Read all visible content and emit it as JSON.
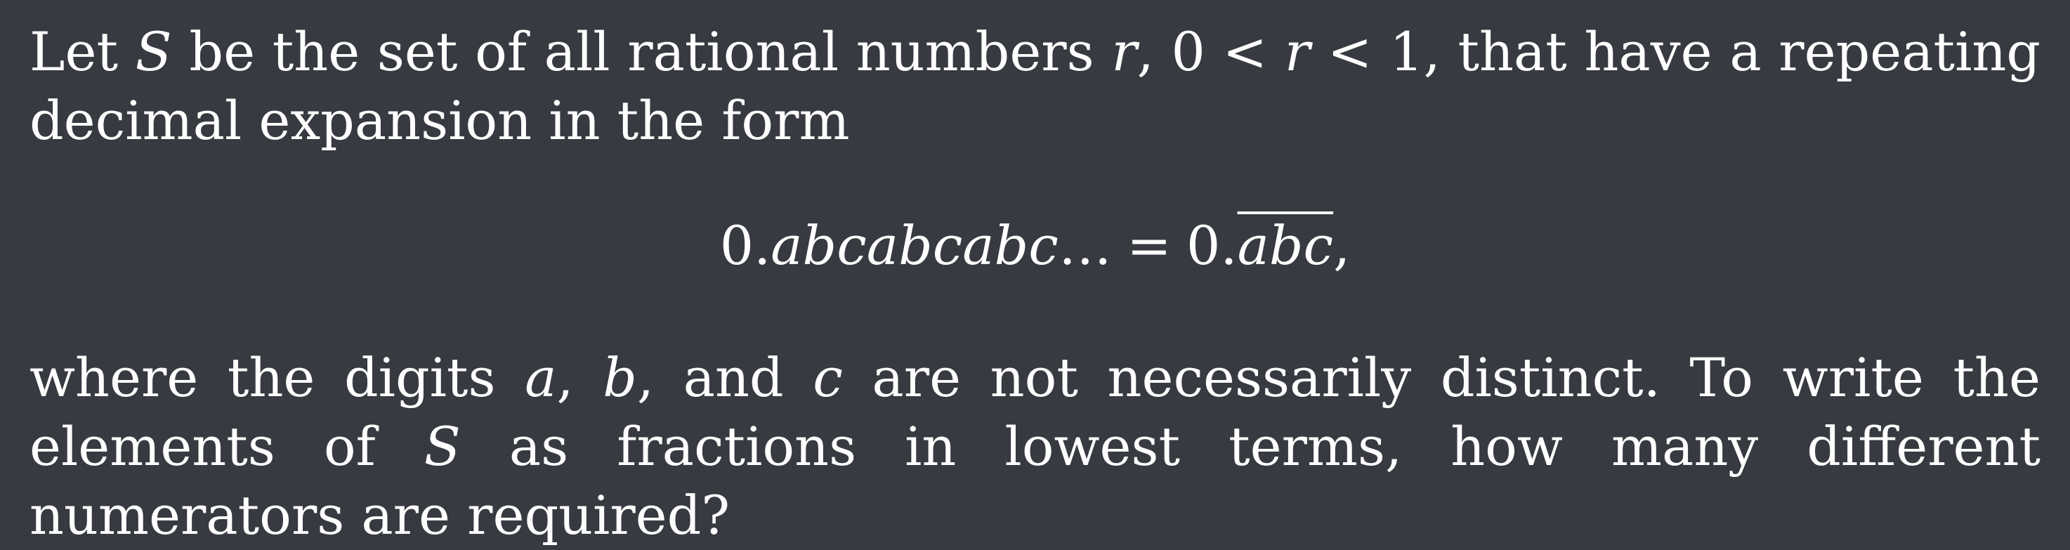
{
  "problem": {
    "p1": {
      "t1": "Let ",
      "v_S": "S",
      "t2": " be the set of all rational numbers ",
      "v_r1": "r",
      "t3": ", 0 < ",
      "v_r2": "r",
      "t4": " < 1, that have a repeating decimal expansion in the form"
    },
    "display": {
      "lead": "0.",
      "repeat": "abcabcabc",
      "dots": "…",
      "eq": "=",
      "lead2": "0.",
      "overlined": "abc",
      "trail": ","
    },
    "p2": {
      "t1": "where the digits ",
      "v_a": "a",
      "t2": ", ",
      "v_b": "b",
      "t3": ", and ",
      "v_c": "c",
      "t4": " are not necessarily distinct. To write the elements of ",
      "v_S": "S",
      "t5": " as fractions in lowest terms, how many different numerators are required?"
    }
  }
}
